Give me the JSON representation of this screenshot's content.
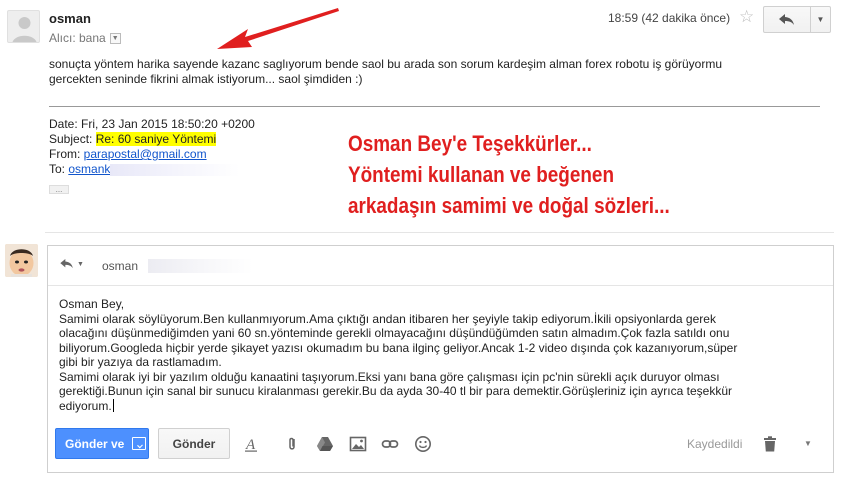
{
  "message": {
    "sender": "osman",
    "recipient_label": "Alıcı: bana",
    "time": "18:59 (42 dakika önce)",
    "body_lines": [
      "sonuçta yöntem harika sayende kazanc saglıyorum bende saol bu arada son sorum kardeşim alman forex robotu iş görüyormu",
      "gercekten seninde fikrini almak istiyorum... saol şimdiden :)"
    ]
  },
  "quoted": {
    "date": "Date: Fri, 23 Jan 2015 18:50:20 +0200",
    "subject_label": "Subject: ",
    "subject_value": "Re: 60 saniye Yöntemi",
    "from_label": "From: ",
    "from_value": "parapostal@gmail.com",
    "to_label": "To: ",
    "to_value": "osmank",
    "more": "..."
  },
  "annotation": {
    "lines": [
      "Osman Bey'e Teşekkürler...",
      "Yöntemi kullanan ve beğenen",
      "arkadaşın samimi ve doğal sözleri..."
    ],
    "color": "#e01f1f"
  },
  "compose": {
    "to_name": "osman",
    "body_lines": [
      "Osman Bey,",
      "Samimi olarak söylüyorum.Ben kullanmıyorum.Ama çıktığı andan itibaren her şeyiyle takip ediyorum.İkili opsiyonlarda gerek",
      "olacağını düşünmediğimden yani 60 sn.yönteminde gerekli olmayacağını düşündüğümden satın almadım.Çok fazla satıldı onu",
      "biliyorum.Googleda hiçbir yerde şikayet yazısı okumadım bu bana ilginç geliyor.Ancak 1-2 video dışında çok kazanıyorum,süper",
      "gibi bir yazıya da rastlamadım.",
      "Samimi olarak iyi bir yazılım olduğu kanaatini taşıyorum.Eksi yanı bana göre çalışması için pc'nin sürekli açık duruyor olması",
      "gerektiği.Bunun için sanal bir sunucu kiralanması gerekir.Bu da ayda 30-40 tl bir para demektir.Görüşleriniz için ayrıca teşekkür",
      "ediyorum."
    ],
    "send_label": "Gönder ve",
    "send_plain_label": "Gönder",
    "saved_label": "Kaydedildi"
  },
  "colors": {
    "send_button": "#4d90fe",
    "link": "#1155cc",
    "highlight": "#ffff00"
  }
}
